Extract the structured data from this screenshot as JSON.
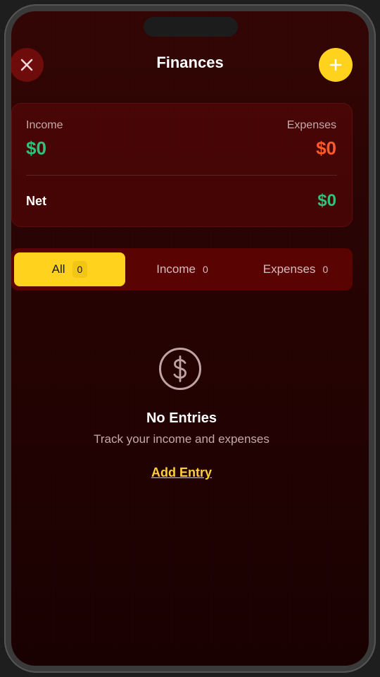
{
  "header": {
    "title": "Finances",
    "close_icon": "close-icon",
    "add_icon": "plus-icon"
  },
  "summary": {
    "income_label": "Income",
    "income_amount": "$0",
    "expenses_label": "Expenses",
    "expenses_amount": "$0",
    "net_label": "Net",
    "net_amount": "$0"
  },
  "tabs": [
    {
      "label": "All",
      "count": "0",
      "active": true
    },
    {
      "label": "Income",
      "count": "0",
      "active": false
    },
    {
      "label": "Expenses",
      "count": "0",
      "active": false
    }
  ],
  "empty_state": {
    "icon": "dollar-circle-icon",
    "title": "No Entries",
    "subtitle": "Track your income and expenses",
    "action_label": "Add Entry"
  },
  "colors": {
    "accent": "#ffd21e",
    "income": "#2fc27a",
    "expense": "#ff5a2c",
    "background": "#260303"
  }
}
